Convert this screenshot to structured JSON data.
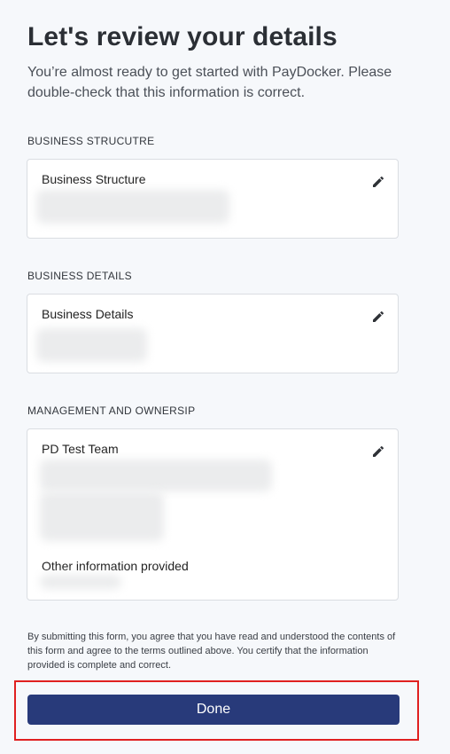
{
  "header": {
    "title": "Let's review your details",
    "subtitle": "You’re almost ready to get started with PayDocker. Please double-check that this information is correct."
  },
  "sections": [
    {
      "heading": "BUSINESS STRUCUTRE",
      "card_title": "Business Structure",
      "edit_icon": "pencil-icon"
    },
    {
      "heading": "BUSINESS DETAILS",
      "card_title": "Business Details",
      "edit_icon": "pencil-icon"
    },
    {
      "heading": "MANAGEMENT AND OWNERSIP",
      "card_title": "PD Test Team",
      "sub_title": "Other information provided",
      "edit_icon": "pencil-icon"
    }
  ],
  "legal": {
    "text": "By submitting this form, you agree that you have read and understood the contents of this form and agree to the terms outlined above. You certify that the information provided is complete and correct."
  },
  "actions": {
    "done_label": "Done"
  },
  "colors": {
    "primary_button": "#283a7a",
    "highlight_outline": "#e02020",
    "background": "#f6f8fb"
  }
}
